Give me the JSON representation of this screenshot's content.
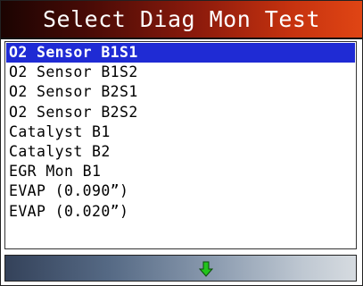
{
  "header": {
    "title": "Select Diag Mon Test"
  },
  "list": {
    "selected_index": 0,
    "items": [
      "O2 Sensor B1S1",
      "O2 Sensor B1S2",
      "O2 Sensor B2S1",
      "O2 Sensor B2S2",
      "Catalyst B1",
      "Catalyst B2",
      "EGR Mon B1",
      "EVAP (0.090”)",
      "EVAP (0.020”)"
    ]
  },
  "footer": {
    "icon": "down-arrow-icon",
    "icon_color": "#22c31c"
  },
  "colors": {
    "title_accent": "#c5320f",
    "selection": "#1f2bd4"
  }
}
